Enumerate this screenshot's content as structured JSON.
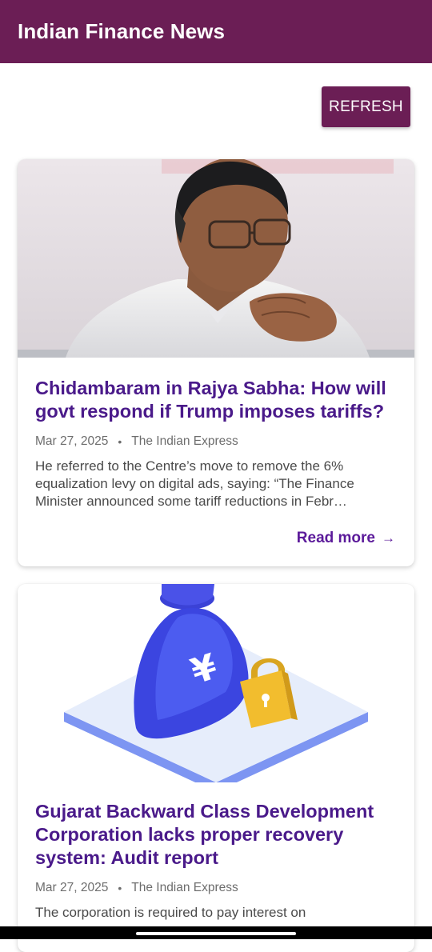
{
  "app": {
    "title": "Indian Finance News"
  },
  "toolbar": {
    "refresh_label": "REFRESH"
  },
  "articles": [
    {
      "headline": "Chidambaram in Rajya Sabha: How will govt respond if Trump imposes tariffs?",
      "date": "Mar 27, 2025",
      "separator": "•",
      "source": "The Indian Express",
      "summary": "He referred to the Centre’s move to remove the 6% equalization levy on digital ads, saying: “The Finance Minister announced some tariff reductions in Febr…",
      "read_more": "Read more",
      "read_more_arrow": "→",
      "image": "photo-of-politician"
    },
    {
      "headline": "Gujarat Backward Class Development Corporation lacks proper recovery system: Audit report",
      "date": "Mar 27, 2025",
      "separator": "•",
      "source": "The Indian Express",
      "summary": "The corporation is required to pay interest on",
      "image": "yen-money-bag-lock-illustration"
    }
  ],
  "colors": {
    "appbar": "#6b1e55",
    "headline": "#4a1a8a",
    "read_more": "#5b1a9a",
    "meta": "#6d6d6d"
  }
}
